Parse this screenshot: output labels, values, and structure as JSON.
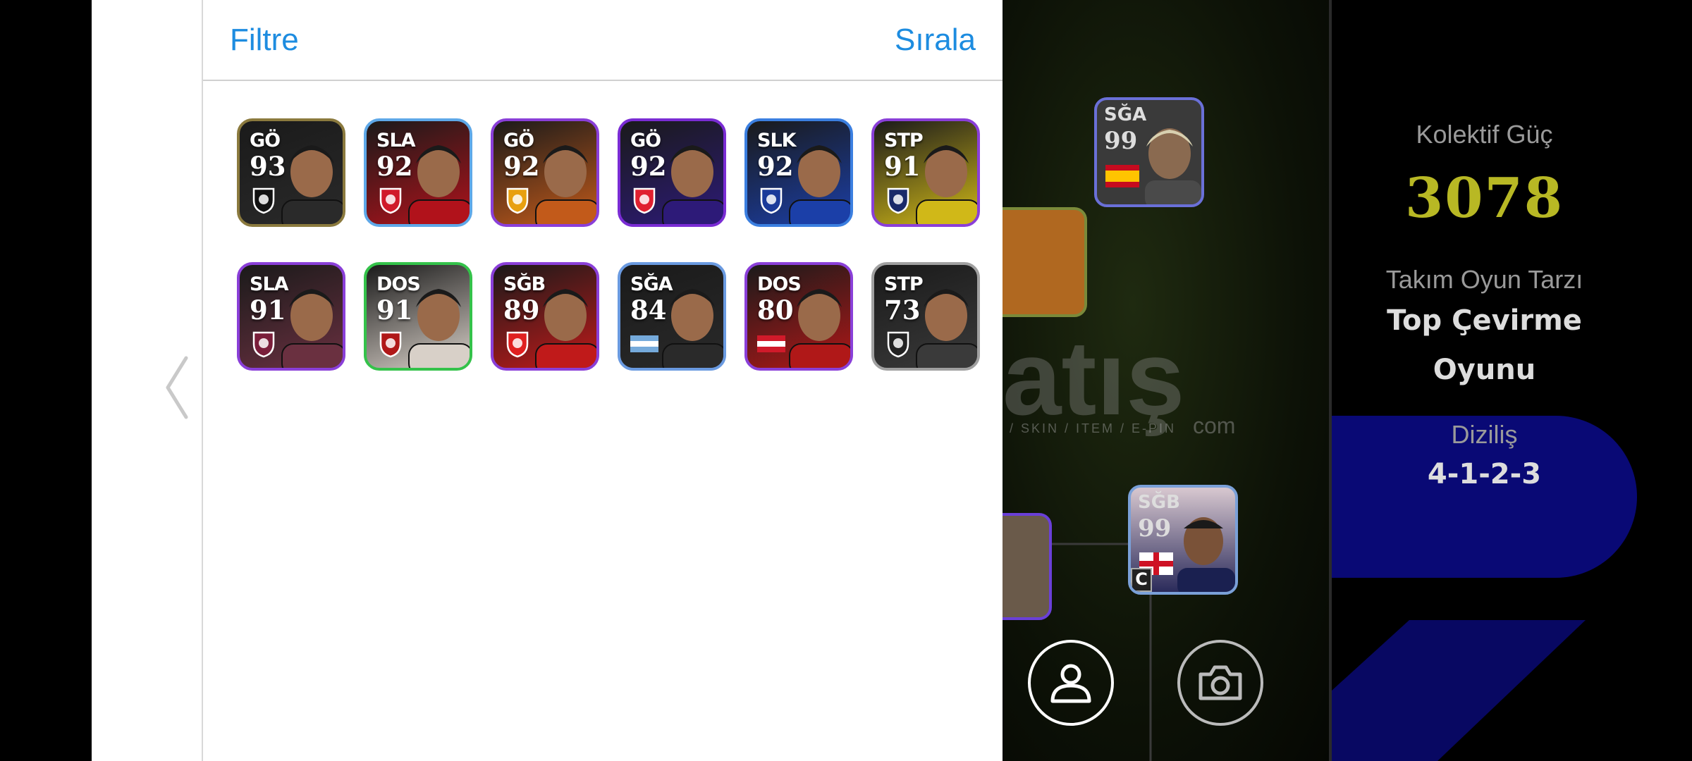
{
  "header": {
    "filter_label": "Filtre",
    "sort_label": "Sırala"
  },
  "players": [
    {
      "pos": "GÖ",
      "ovr": "93",
      "frame": "#8b7a3e",
      "bg": "#2a2a2a",
      "badge_icon": "botafogo-star-badge-icon",
      "badge_color": "#111"
    },
    {
      "pos": "SLA",
      "ovr": "92",
      "frame": "#5ea8e8",
      "bg": "#b1121b",
      "badge_icon": "club-badge-icon",
      "badge_color": "#d01a2a"
    },
    {
      "pos": "GÖ",
      "ovr": "92",
      "frame": "#8a3fd8",
      "bg": "#c25a1a",
      "badge_icon": "galatasaray-badge-icon",
      "badge_color": "#e8a010"
    },
    {
      "pos": "GÖ",
      "ovr": "92",
      "frame": "#7a2cd4",
      "bg": "#2d1a78",
      "badge_icon": "psv-badge-icon",
      "badge_color": "#e02030"
    },
    {
      "pos": "SLK",
      "ovr": "92",
      "frame": "#3b7fe0",
      "bg": "#1b3fa8",
      "badge_icon": "club-badge-icon",
      "badge_color": "#1a3a9a"
    },
    {
      "pos": "STP",
      "ovr": "91",
      "frame": "#8a3fd8",
      "bg": "#d0b818",
      "badge_icon": "fenerbahce-badge-icon",
      "badge_color": "#1a2a6a"
    },
    {
      "pos": "SLA",
      "ovr": "91",
      "frame": "#8a3fd8",
      "bg": "#6a3040",
      "badge_icon": "trabzonspor-badge-icon",
      "badge_color": "#7a1e3a"
    },
    {
      "pos": "DOS",
      "ovr": "91",
      "frame": "#34c24a",
      "bg": "#d8d0c8",
      "badge_icon": "club-badge-icon",
      "badge_color": "#b01818"
    },
    {
      "pos": "SĞB",
      "ovr": "89",
      "frame": "#8a3fd8",
      "bg": "#c01a1a",
      "badge_icon": "samsunspor-badge-icon",
      "badge_color": "#e02020"
    },
    {
      "pos": "SĞA",
      "ovr": "84",
      "frame": "#6a9ae0",
      "bg": "#2a2a2a",
      "badge_icon": "argentina-flag-icon",
      "badge_color": "#75aadb"
    },
    {
      "pos": "DOS",
      "ovr": "80",
      "frame": "#8a3fd8",
      "bg": "#b01818",
      "badge_icon": "austria-flag-icon",
      "badge_color": "#d01a2a"
    },
    {
      "pos": "STP",
      "ovr": "73",
      "frame": "#a0a0a0",
      "bg": "#3a3a3a",
      "badge_icon": "club-badge-icon",
      "badge_color": "#222"
    }
  ],
  "field": {
    "top_card": {
      "pos": "SĞA",
      "ovr": "99",
      "flag_icon": "spain-flag-icon"
    },
    "bottom_card": {
      "pos": "SĞB",
      "ovr": "99",
      "flag_icon": "england-flag-icon",
      "captain_label": "C"
    },
    "watermark": "atış",
    "watermark_com": "com",
    "watermark_sub": "/ SKIN / ITEM / E-PIN"
  },
  "stats": {
    "power_label": "Kolektif Güç",
    "power_value": "3078",
    "style_label": "Takım Oyun Tarzı",
    "style_value_line1": "Top Çevirme",
    "style_value_line2": "Oyunu",
    "formation_label": "Diziliş",
    "formation_value": "4-1-2-3"
  },
  "colors": {
    "accent_blue": "#1d8ce0",
    "power_yellow": "#b8b824"
  }
}
